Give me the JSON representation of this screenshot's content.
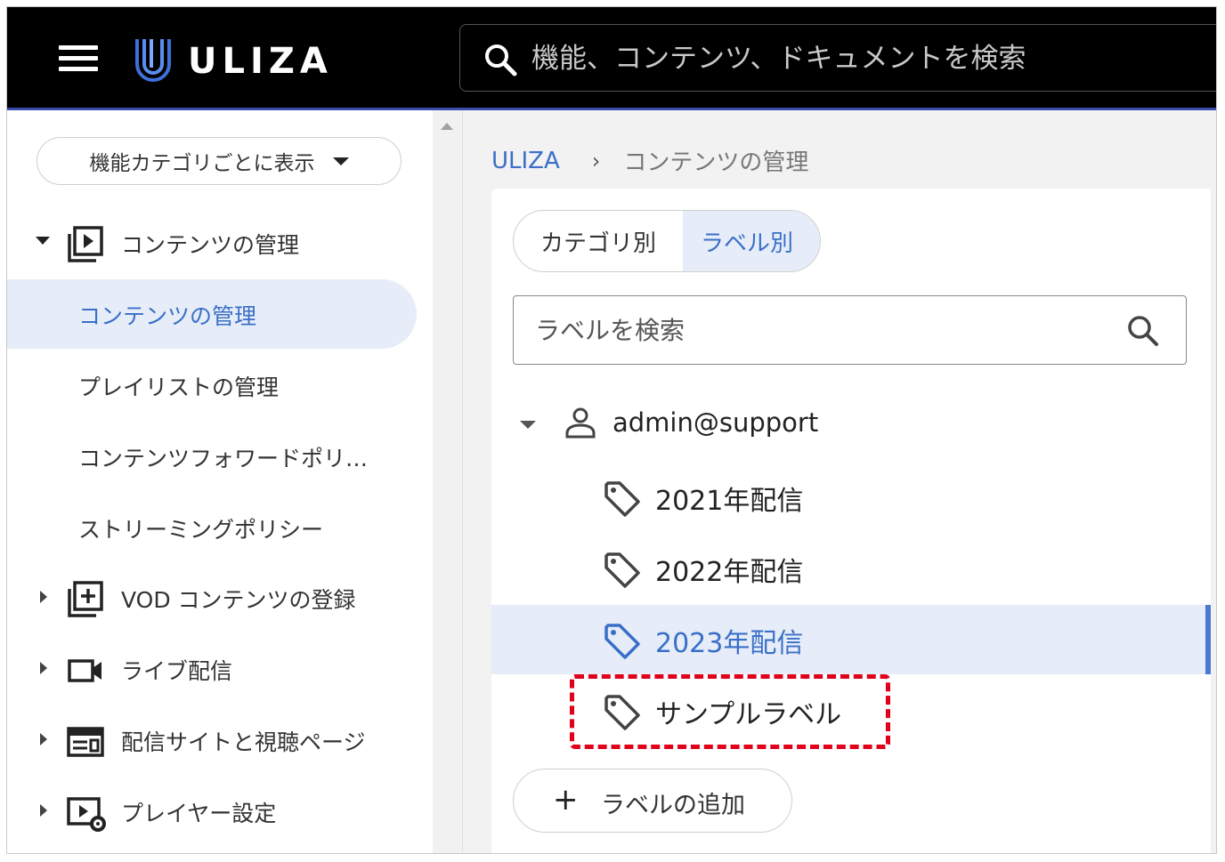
{
  "header": {
    "brand": "ULIZA",
    "search_placeholder": "機能、コンテンツ、ドキュメントを検索"
  },
  "sidebar": {
    "category_button": "機能カテゴリごとに表示",
    "groups": [
      {
        "label": "コンテンツの管理",
        "expanded": true,
        "icon": "play-library-icon"
      },
      {
        "label": "VOD コンテンツの登録",
        "expanded": false,
        "icon": "add-library-icon"
      },
      {
        "label": "ライブ配信",
        "expanded": false,
        "icon": "video-camera-icon"
      },
      {
        "label": "配信サイトと視聴ページ",
        "expanded": false,
        "icon": "web-layout-icon"
      },
      {
        "label": "プレイヤー設定",
        "expanded": false,
        "icon": "player-settings-icon"
      }
    ],
    "items": [
      {
        "label": "コンテンツの管理",
        "active": true
      },
      {
        "label": "プレイリストの管理",
        "active": false
      },
      {
        "label": "コンテンツフォワードポリ…",
        "active": false
      },
      {
        "label": "ストリーミングポリシー",
        "active": false
      }
    ]
  },
  "breadcrumb": {
    "home": "ULIZA",
    "separator": "›",
    "current": "コンテンツの管理"
  },
  "labels_panel": {
    "tabs": [
      {
        "label": "カテゴリ別",
        "active": false
      },
      {
        "label": "ラベル別",
        "active": true
      }
    ],
    "search_placeholder": "ラベルを検索",
    "owner": "admin@support",
    "labels": [
      {
        "label": "2021年配信",
        "selected": false
      },
      {
        "label": "2022年配信",
        "selected": false
      },
      {
        "label": "2023年配信",
        "selected": true
      },
      {
        "label": "サンプルラベル",
        "selected": false
      }
    ],
    "add_button": "ラベルの追加"
  },
  "colors": {
    "accent": "#3a6fc8",
    "selected_bg": "#e6edf8",
    "highlight_dash": "#e0001a",
    "topbar_bg": "#000000"
  }
}
